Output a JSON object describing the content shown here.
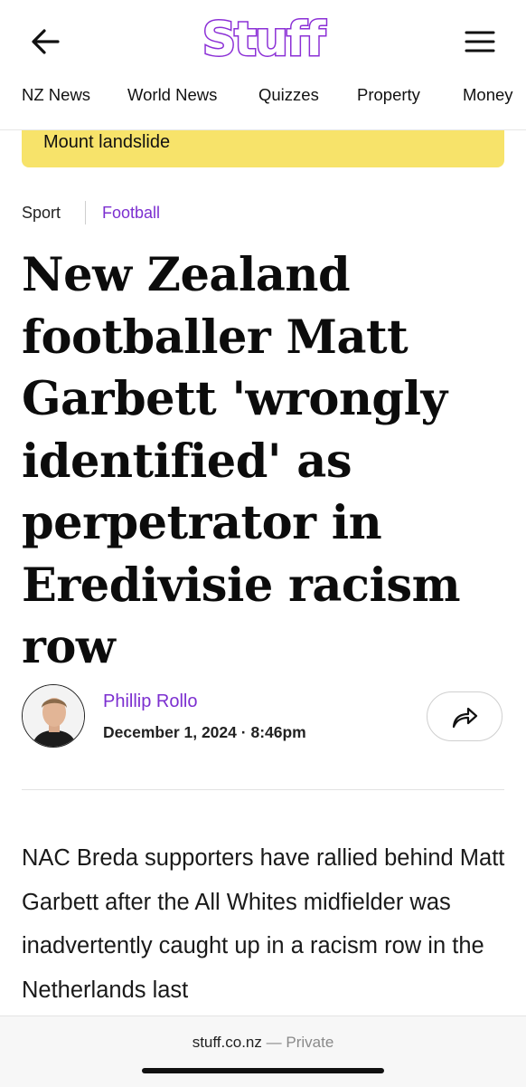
{
  "header": {
    "logo_text": "Stuff",
    "nav": [
      "NZ News",
      "World News",
      "Quizzes",
      "Property",
      "Money"
    ]
  },
  "banner": {
    "label": "Mount landslide"
  },
  "breadcrumb": {
    "section": "Sport",
    "subsection": "Football"
  },
  "article": {
    "headline": "New Zealand footballer Matt Garbett 'wrongly identified' as perpetrator in Eredivisie racism row",
    "author": "Phillip Rollo",
    "date": "December 1, 2024",
    "separator": "·",
    "time": "8:46pm",
    "body": "NAC Breda supporters have rallied behind Matt Garbett after the All Whites midfielder was inadvertently caught up in a racism row in the Netherlands last"
  },
  "browser": {
    "domain": "stuff.co.nz",
    "separator": "—",
    "mode": "Private"
  },
  "colors": {
    "brand_purple": "#7c2fd0",
    "banner_yellow": "#f7e36a"
  },
  "icons": [
    "back-arrow-icon",
    "hamburger-menu-icon",
    "share-icon"
  ]
}
